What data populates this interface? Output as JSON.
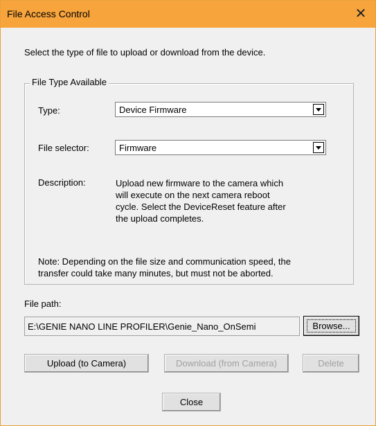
{
  "window": {
    "title": "File Access Control",
    "close_glyph": "✕"
  },
  "intro": "Select the type of file to upload or download from the device.",
  "group": {
    "legend": "File Type Available",
    "type_label": "Type:",
    "type_value": "Device Firmware",
    "selector_label": "File selector:",
    "selector_value": "Firmware",
    "description_label": "Description:",
    "description_lines": [
      "Upload new firmware to the camera which",
      "will execute on the next camera reboot",
      "cycle. Select the DeviceReset feature after",
      "the upload completes."
    ],
    "note_lines": [
      "Note: Depending on the file size and communication speed, the",
      "transfer could take many minutes, but must not be aborted."
    ]
  },
  "file_path": {
    "label": "File path:",
    "value": "E:\\GENIE NANO LINE PROFILER\\Genie_Nano_OnSemi",
    "browse_label": "Browse..."
  },
  "buttons": {
    "upload": "Upload (to Camera)",
    "download": "Download (from Camera)",
    "delete": "Delete",
    "close": "Close"
  }
}
